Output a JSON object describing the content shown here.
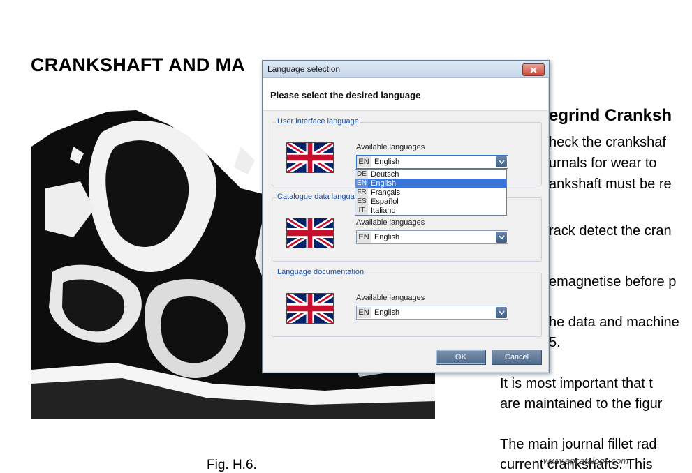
{
  "document": {
    "title": "CRANKSHAFT AND MA",
    "fig_caption": "Fig. H.6.",
    "right_lines": [
      "egrind Cranksh",
      "heck  the  crankshaf",
      "urnals  for  wear  to",
      "ankshaft must be re",
      "rack detect the cran",
      "emagnetise before p",
      "he data and machine",
      "5.",
      "It  is  most  important  that  t",
      "are maintained to the figur",
      "The  main  journal  fillet  rad",
      "current crankshafts.  This"
    ],
    "watermark": "www.epcatalogs.com"
  },
  "dialog": {
    "title": "Language selection",
    "prompt": "Please select the desired language",
    "groups": [
      {
        "legend": "User interface language",
        "label": "Available languages",
        "code": "EN",
        "value": "English",
        "flag": "uk-flag-icon"
      },
      {
        "legend": "Catalogue data langua",
        "label": "Available languages",
        "code": "EN",
        "value": "English",
        "flag": "uk-flag-icon"
      },
      {
        "legend": "Language documentation",
        "label": "Available languages",
        "code": "EN",
        "value": "English",
        "flag": "uk-flag-icon"
      }
    ],
    "dropdown_options": [
      {
        "code": "DE",
        "name": "Deutsch"
      },
      {
        "code": "EN",
        "name": "English",
        "selected": true
      },
      {
        "code": "FR",
        "name": "Français"
      },
      {
        "code": "ES",
        "name": "Español"
      },
      {
        "code": "IT",
        "name": "Italiano"
      }
    ],
    "ok_label": "OK",
    "cancel_label": "Cancel"
  },
  "colors": {
    "dialog_bg": "#f0f0f0",
    "legend_text": "#1c4f9c",
    "selection": "#3875d7",
    "button": "#5a7496",
    "close_button": "#c8473a"
  }
}
